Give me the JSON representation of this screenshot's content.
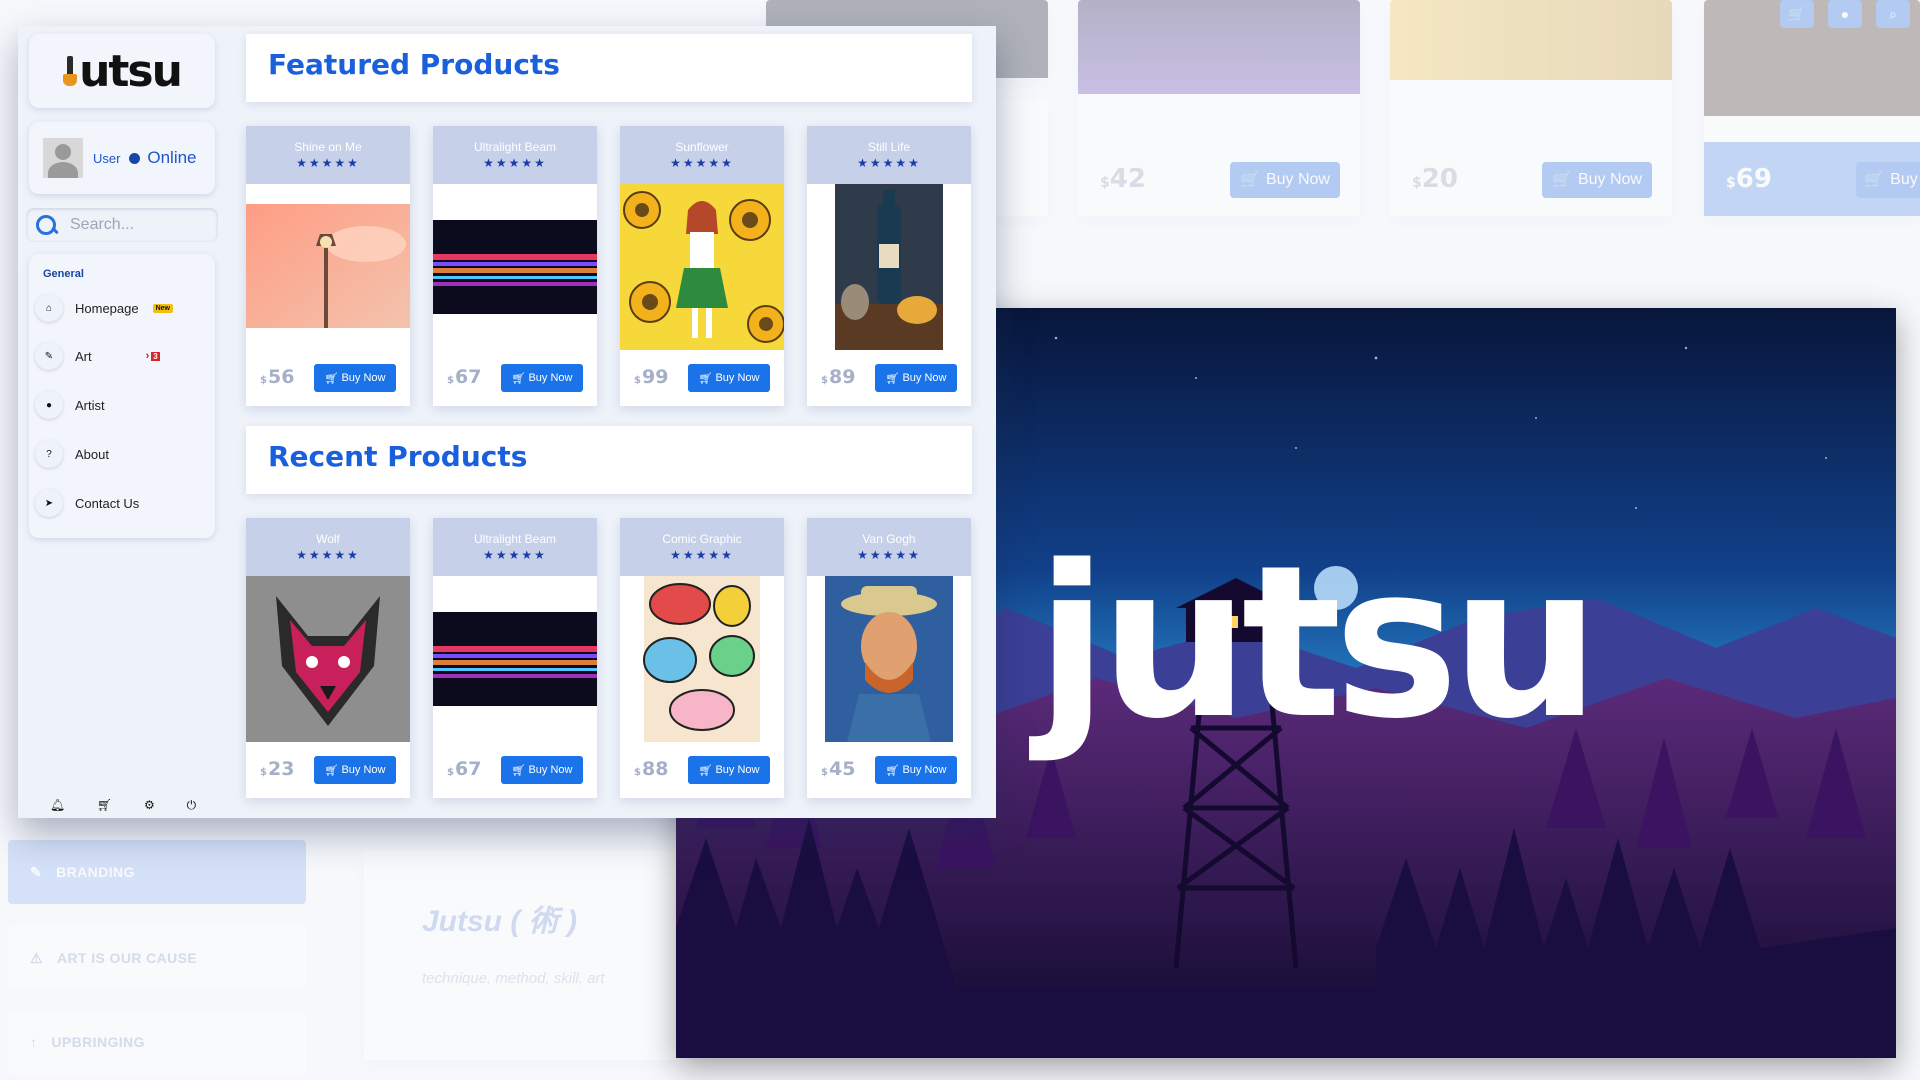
{
  "background_page": {
    "products": [
      {
        "price_symbol": "$",
        "price": "42",
        "buy_label": "Buy Now"
      },
      {
        "price_symbol": "$",
        "price": "20",
        "buy_label": "Buy Now"
      },
      {
        "price_symbol": "$",
        "price": "69",
        "buy_label": "Buy"
      }
    ],
    "side_buttons": [
      "BRANDING",
      "ART IS OUR CAUSE",
      "UPBRINGING"
    ],
    "title": "Jutsu ( 術 )",
    "subtitle": "technique, method, skill, art"
  },
  "hero": {
    "word": "jutsu"
  },
  "sidebar": {
    "logo_text": "utsu",
    "user": {
      "name": "User",
      "status": "Online"
    },
    "search": {
      "placeholder": "Search..."
    },
    "nav_heading": "General",
    "nav_items": [
      {
        "label": "Homepage",
        "icon": "home-icon",
        "badge": "New"
      },
      {
        "label": "Art",
        "icon": "brush-icon",
        "chevron": "›",
        "count": "3"
      },
      {
        "label": "Artist",
        "icon": "user-icon"
      },
      {
        "label": "About",
        "icon": "info-icon"
      },
      {
        "label": "Contact Us",
        "icon": "send-icon"
      }
    ],
    "bottom_icons": [
      "bell-icon",
      "cart-icon",
      "gear-icon",
      "power-icon"
    ]
  },
  "featured": {
    "title": "Featured Products",
    "products": [
      {
        "name": "Shine on Me",
        "stars": "★★★★★",
        "price_symbol": "$",
        "price": "56",
        "buy_label": "Buy Now"
      },
      {
        "name": "Ultralight Beam",
        "stars": "★★★★★",
        "price_symbol": "$",
        "price": "67",
        "buy_label": "Buy Now"
      },
      {
        "name": "Sunflower",
        "stars": "★★★★★",
        "price_symbol": "$",
        "price": "99",
        "buy_label": "Buy Now"
      },
      {
        "name": "Still Life",
        "stars": "★★★★★",
        "price_symbol": "$",
        "price": "89",
        "buy_label": "Buy Now"
      }
    ]
  },
  "recent": {
    "title": "Recent Products",
    "products": [
      {
        "name": "Wolf",
        "stars": "★★★★★",
        "price_symbol": "$",
        "price": "23",
        "buy_label": "Buy Now"
      },
      {
        "name": "Ultralight Beam",
        "stars": "★★★★★",
        "price_symbol": "$",
        "price": "67",
        "buy_label": "Buy Now"
      },
      {
        "name": "Comic Graphic",
        "stars": "★★★★★",
        "price_symbol": "$",
        "price": "88",
        "buy_label": "Buy Now"
      },
      {
        "name": "Van Gogh",
        "stars": "★★★★★",
        "price_symbol": "$",
        "price": "45",
        "buy_label": "Buy Now"
      }
    ]
  },
  "colors": {
    "accent": "#1a5fdc",
    "button": "#1a73e8",
    "card_header": "#c6d0e9",
    "panel": "#eef2f9"
  }
}
